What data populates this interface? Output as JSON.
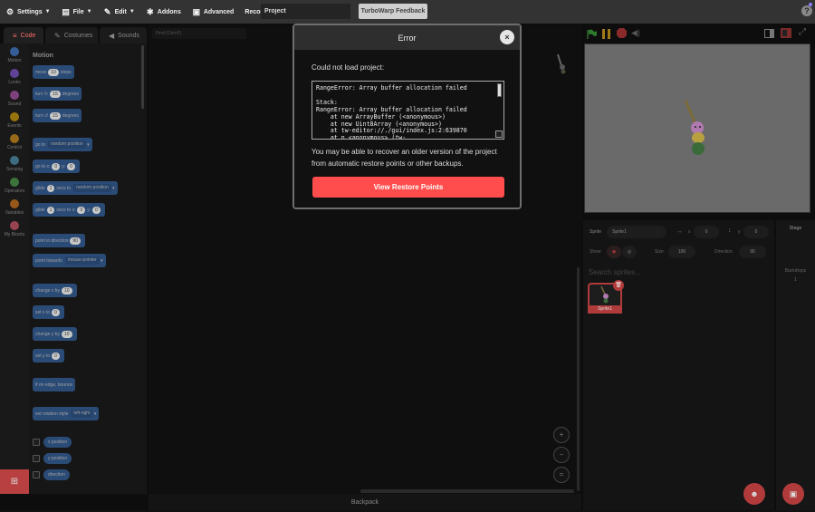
{
  "menubar": {
    "settings": "Settings",
    "file": "File",
    "edit": "Edit",
    "addons": "Addons",
    "advanced": "Advanced",
    "record": "Record",
    "project_title": "Project",
    "feedback": "TurboWarp Feedback",
    "help": "?"
  },
  "tabs": {
    "code": "Code",
    "costumes": "Costumes",
    "sounds": "Sounds"
  },
  "categories": [
    {
      "label": "Motion",
      "color": "#4c97ff"
    },
    {
      "label": "Looks",
      "color": "#9966ff"
    },
    {
      "label": "Sound",
      "color": "#cf63cf"
    },
    {
      "label": "Events",
      "color": "#ffbf00"
    },
    {
      "label": "Control",
      "color": "#ffab19"
    },
    {
      "label": "Sensing",
      "color": "#5cb1d6"
    },
    {
      "label": "Operators",
      "color": "#59c059"
    },
    {
      "label": "Variables",
      "color": "#ff8c1a"
    },
    {
      "label": "My Blocks",
      "color": "#ff6680"
    }
  ],
  "palette": {
    "title": "Motion",
    "move": {
      "a": "move",
      "v": "10",
      "b": "steps"
    },
    "turn_right": {
      "a": "turn",
      "v": "15",
      "b": "degrees"
    },
    "turn_left": {
      "a": "turn",
      "v": "15",
      "b": "degrees"
    },
    "goto": {
      "a": "go to",
      "dd": "random position"
    },
    "gotoxy": {
      "a": "go to x:",
      "x": "0",
      "b": "y:",
      "y": "0"
    },
    "glide1": {
      "a": "glide",
      "v": "1",
      "b": "secs to",
      "dd": "random position"
    },
    "glide2": {
      "a": "glide",
      "v": "1",
      "b": "secs to x:",
      "x": "0",
      "c": "y:",
      "y": "0"
    },
    "point_dir": {
      "a": "point in direction",
      "v": "90"
    },
    "point_towards": {
      "a": "point towards",
      "dd": "mouse-pointer"
    },
    "change_x": {
      "a": "change x by",
      "v": "10"
    },
    "set_x": {
      "a": "set x to",
      "v": "0"
    },
    "change_y": {
      "a": "change y by",
      "v": "10"
    },
    "set_y": {
      "a": "set y to",
      "v": "0"
    },
    "bounce": {
      "a": "if on edge, bounce"
    },
    "rotation": {
      "a": "set rotation style",
      "dd": "left-right"
    },
    "reporters": [
      "x position",
      "y position",
      "direction"
    ]
  },
  "workspace": {
    "find_placeholder": "Find (Ctrl+F)",
    "backpack": "Backpack"
  },
  "sprite_info": {
    "sprite_label": "Sprite",
    "sprite_name": "Sprite1",
    "x_label": "x",
    "x": "0",
    "y_label": "y",
    "y": "0",
    "show_label": "Show",
    "size_label": "Size",
    "size": "100",
    "direction_label": "Direction",
    "direction": "90"
  },
  "sprites": {
    "search_placeholder": "Search sprites...",
    "items": [
      {
        "name": "Sprite1"
      }
    ]
  },
  "stage_pane": {
    "title": "Stage",
    "backdrops_label": "Backdrops",
    "backdrops_count": "1"
  },
  "modal": {
    "title": "Error",
    "close": "×",
    "heading": "Could not load project:",
    "error_text": "RangeError: Array buffer allocation failed\n\nStack:\nRangeError: Array buffer allocation failed\n    at new ArrayBuffer (<anonymous>)\n    at new Uint8Array (<anonymous>)\n    at tw-editor://./gui/index.js:2:639870\n    at n.<anonymous> (tw-",
    "message": "You may be able to recover an older version of the project from automatic restore points or other backups.",
    "restore_button": "View Restore Points"
  },
  "colors": {
    "accent": "#ff4c4c",
    "motion_block": "#4c97ff",
    "menubar": "#333333"
  }
}
